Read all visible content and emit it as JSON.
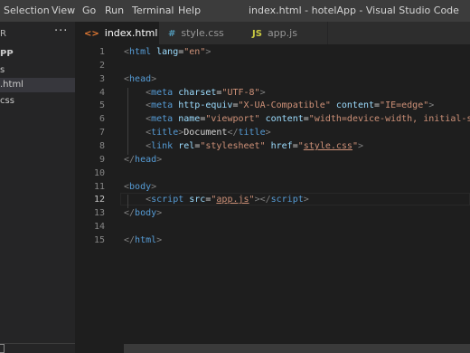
{
  "menubar": {
    "items": [
      "Selection",
      "View",
      "Go",
      "Run",
      "Terminal",
      "Help"
    ],
    "window_title": "index.html - hotelApp - Visual Studio Code"
  },
  "sidebar": {
    "header": "R",
    "folder": "PP",
    "items": [
      "s",
      ".html",
      "css"
    ],
    "active_index": 1
  },
  "tabs": [
    {
      "label": "index.html",
      "icon": "<>",
      "icon_color": "#e37933",
      "active": true,
      "close": "×"
    },
    {
      "label": "style.css",
      "icon": "#",
      "icon_color": "#519aba",
      "active": false
    },
    {
      "label": "app.js",
      "icon": "JS",
      "icon_color": "#cbcb41",
      "active": false
    }
  ],
  "editor": {
    "current_line": 12,
    "lines": [
      [
        [
          "t",
          "<"
        ],
        [
          "tg",
          "html"
        ],
        [
          "",
          ""
        ],
        [
          "at",
          " lang"
        ],
        [
          "",
          "="
        ],
        [
          "st",
          "\"en\""
        ],
        [
          "t",
          ">"
        ]
      ],
      [],
      [
        [
          "t",
          "<"
        ],
        [
          "tg",
          "head"
        ],
        [
          "t",
          ">"
        ]
      ],
      [
        [
          "",
          "    "
        ],
        [
          "t",
          "<"
        ],
        [
          "tg",
          "meta"
        ],
        [
          "at",
          " charset"
        ],
        [
          "",
          "="
        ],
        [
          "st",
          "\"UTF-8\""
        ],
        [
          "t",
          ">"
        ]
      ],
      [
        [
          "",
          "    "
        ],
        [
          "t",
          "<"
        ],
        [
          "tg",
          "meta"
        ],
        [
          "at",
          " http-equiv"
        ],
        [
          "",
          "="
        ],
        [
          "st",
          "\"X-UA-Compatible\""
        ],
        [
          "at",
          " content"
        ],
        [
          "",
          "="
        ],
        [
          "st",
          "\"IE=edge\""
        ],
        [
          "t",
          ">"
        ]
      ],
      [
        [
          "",
          "    "
        ],
        [
          "t",
          "<"
        ],
        [
          "tg",
          "meta"
        ],
        [
          "at",
          " name"
        ],
        [
          "",
          "="
        ],
        [
          "st",
          "\"viewport\""
        ],
        [
          "at",
          " content"
        ],
        [
          "",
          "="
        ],
        [
          "st",
          "\"width=device-width, initial-s"
        ]
      ],
      [
        [
          "",
          "    "
        ],
        [
          "t",
          "<"
        ],
        [
          "tg",
          "title"
        ],
        [
          "t",
          ">"
        ],
        [
          "",
          "Document"
        ],
        [
          "t",
          "</"
        ],
        [
          "tg",
          "title"
        ],
        [
          "t",
          ">"
        ]
      ],
      [
        [
          "",
          "    "
        ],
        [
          "t",
          "<"
        ],
        [
          "tg",
          "link"
        ],
        [
          "at",
          " rel"
        ],
        [
          "",
          "="
        ],
        [
          "st",
          "\"stylesheet\""
        ],
        [
          "at",
          " href"
        ],
        [
          "",
          "="
        ],
        [
          "st",
          "\""
        ],
        [
          "st u",
          "style.css"
        ],
        [
          "st",
          "\""
        ],
        [
          "t",
          ">"
        ]
      ],
      [
        [
          "t",
          "</"
        ],
        [
          "tg",
          "head"
        ],
        [
          "t",
          ">"
        ]
      ],
      [],
      [
        [
          "t",
          "<"
        ],
        [
          "tg",
          "body"
        ],
        [
          "t",
          ">"
        ]
      ],
      [
        [
          "",
          "    "
        ],
        [
          "t",
          "<"
        ],
        [
          "tg",
          "script"
        ],
        [
          "at",
          " src"
        ],
        [
          "",
          "="
        ],
        [
          "st",
          "\""
        ],
        [
          "st u",
          "app.js"
        ],
        [
          "st",
          "\""
        ],
        [
          "t",
          "></"
        ],
        [
          "tg",
          "script"
        ],
        [
          "t",
          ">"
        ]
      ],
      [
        [
          "t",
          "</"
        ],
        [
          "tg",
          "body"
        ],
        [
          "t",
          ">"
        ]
      ],
      [],
      [
        [
          "t",
          "</"
        ],
        [
          "tg",
          "html"
        ],
        [
          "t",
          ">"
        ]
      ]
    ]
  }
}
